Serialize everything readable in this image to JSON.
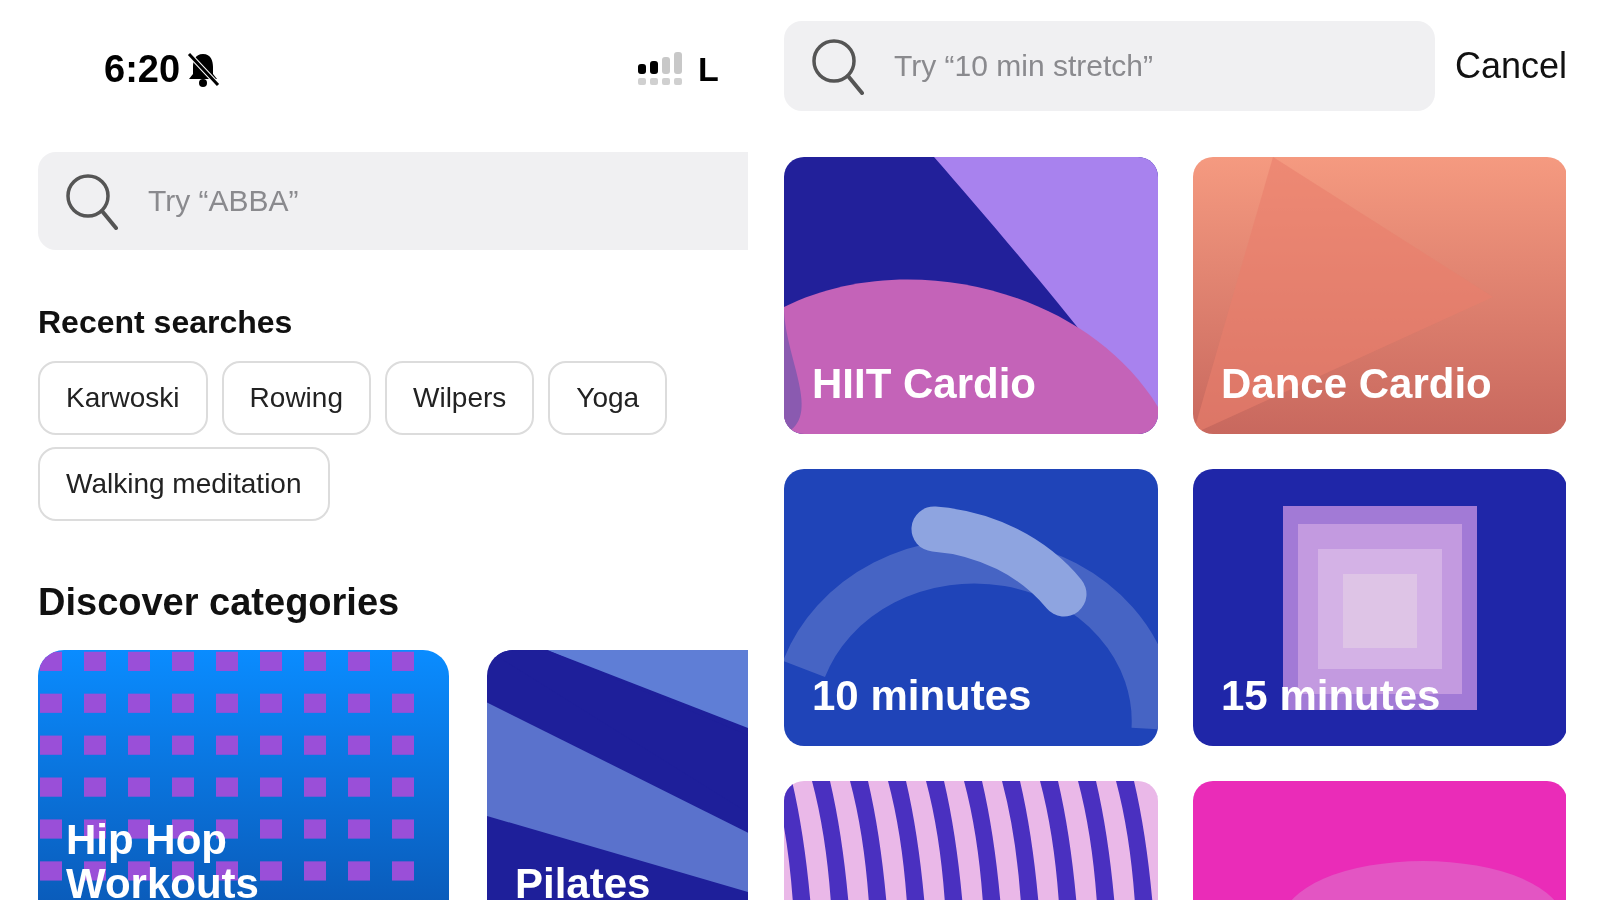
{
  "status_bar": {
    "time": "6:20",
    "carrier": "L"
  },
  "left": {
    "search": {
      "placeholder": "Try “ABBA”"
    },
    "recent_title": "Recent searches",
    "recent": [
      "Karwoski",
      "Rowing",
      "Wilpers",
      "Yoga",
      "Walking meditation"
    ],
    "discover_title": "Discover categories",
    "categories": [
      {
        "label": "Hip Hop Workouts",
        "kind": "grid"
      },
      {
        "label": "Pilates",
        "kind": "rays"
      }
    ]
  },
  "right": {
    "search": {
      "placeholder": "Try “10 min stretch”"
    },
    "cancel": "Cancel",
    "categories": [
      {
        "label": "HIIT Cardio",
        "kind": "petals"
      },
      {
        "label": "Dance Cardio",
        "kind": "triangle"
      },
      {
        "label": "10 minutes",
        "kind": "arc"
      },
      {
        "label": "15 minutes",
        "kind": "squares"
      },
      {
        "kind": "stripes"
      },
      {
        "kind": "swirl"
      }
    ]
  }
}
